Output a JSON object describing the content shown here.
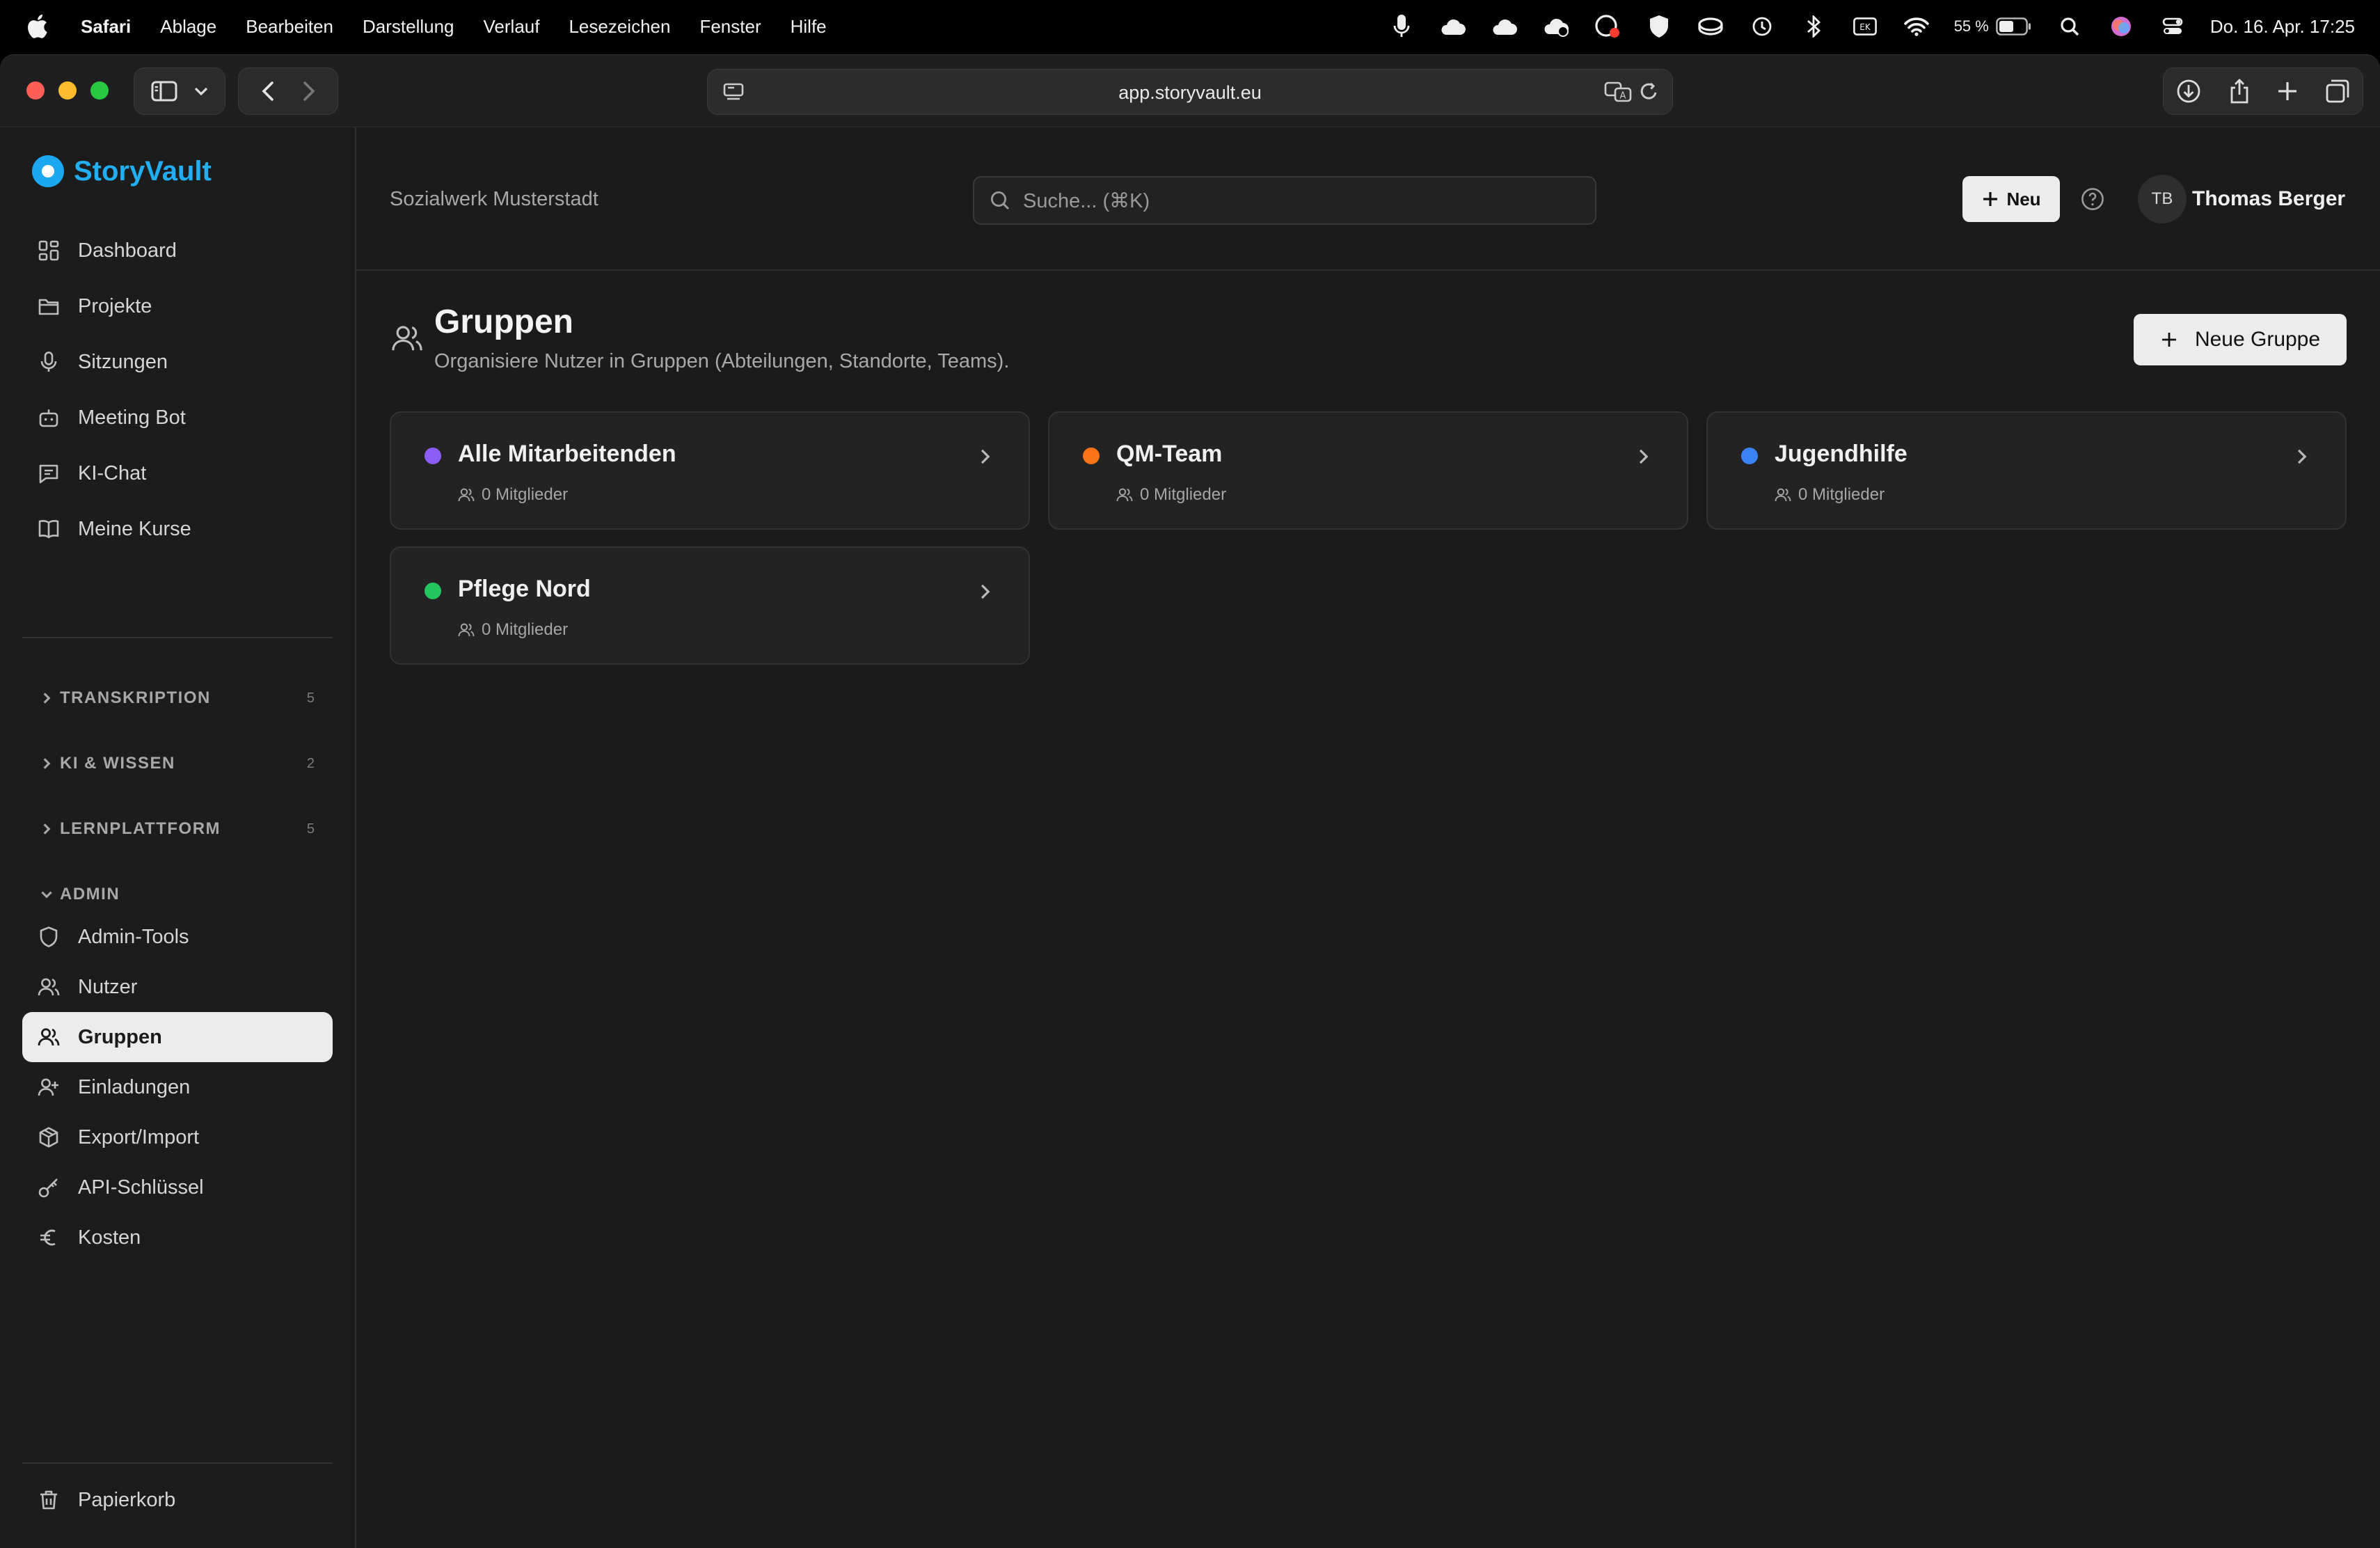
{
  "menubar": {
    "app": "Safari",
    "items": [
      "Ablage",
      "Bearbeiten",
      "Darstellung",
      "Verlauf",
      "Lesezeichen",
      "Fenster",
      "Hilfe"
    ],
    "battery": "55 %",
    "clock": "Do. 16. Apr.  17:25"
  },
  "browser": {
    "url": "app.storyvault.eu"
  },
  "sidebar": {
    "brand": "StoryVault",
    "main_items": [
      {
        "label": "Dashboard",
        "icon": "dashboard-icon"
      },
      {
        "label": "Projekte",
        "icon": "folder-icon"
      },
      {
        "label": "Sitzungen",
        "icon": "microphone-icon"
      },
      {
        "label": "Meeting Bot",
        "icon": "bot-icon"
      },
      {
        "label": "KI-Chat",
        "icon": "chat-icon"
      },
      {
        "label": "Meine Kurse",
        "icon": "book-icon"
      }
    ],
    "sections": [
      {
        "label": "TRANSKRIPTION",
        "count": "5"
      },
      {
        "label": "KI & WISSEN",
        "count": "2"
      },
      {
        "label": "LERNPLATTFORM",
        "count": "5"
      }
    ],
    "admin_label": "ADMIN",
    "admin_items": [
      {
        "label": "Admin-Tools",
        "icon": "shield-icon"
      },
      {
        "label": "Nutzer",
        "icon": "users-icon"
      },
      {
        "label": "Gruppen",
        "icon": "group-icon"
      },
      {
        "label": "Einladungen",
        "icon": "user-plus-icon"
      },
      {
        "label": "Export/Import",
        "icon": "package-icon"
      },
      {
        "label": "API-Schlüssel",
        "icon": "key-icon"
      },
      {
        "label": "Kosten",
        "icon": "euro-icon"
      }
    ],
    "trash": "Papierkorb"
  },
  "topbar": {
    "org": "Sozialwerk Musterstadt",
    "search_placeholder": "Suche... (⌘K)",
    "new_label": "Neu",
    "avatar_initials": "TB",
    "user_name": "Thomas Berger"
  },
  "page": {
    "title": "Gruppen",
    "subtitle": "Organisiere Nutzer in Gruppen (Abteilungen, Standorte, Teams).",
    "new_group_label": "Neue Gruppe"
  },
  "groups": [
    {
      "name": "Alle Mitarbeitenden",
      "members": "0 Mitglieder",
      "color": "#8b5cf6"
    },
    {
      "name": "QM-Team",
      "members": "0 Mitglieder",
      "color": "#f97316"
    },
    {
      "name": "Jugendhilfe",
      "members": "0 Mitglieder",
      "color": "#3b82f6"
    },
    {
      "name": "Pflege Nord",
      "members": "0 Mitglieder",
      "color": "#22c55e"
    }
  ],
  "colors": {
    "brand": "#1ba8f0",
    "background": "#1b1b1b",
    "active_nav": "#ececec"
  }
}
